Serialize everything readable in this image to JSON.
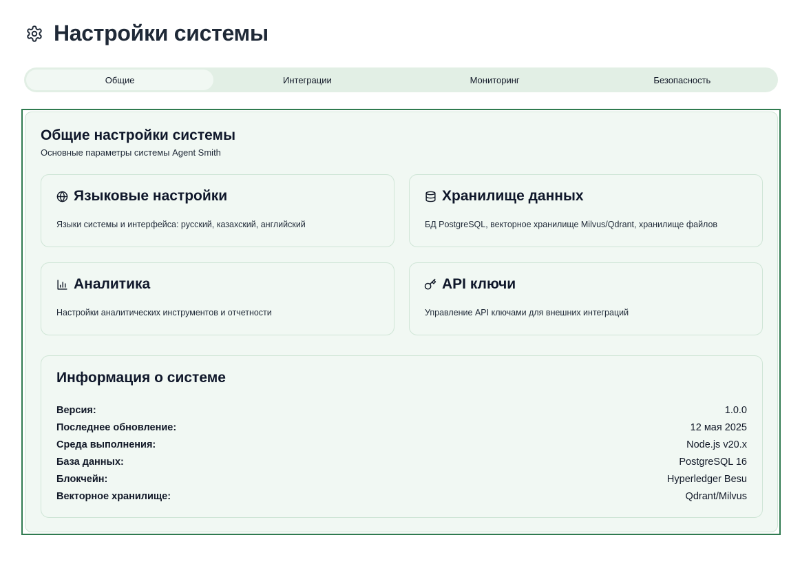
{
  "page": {
    "title": "Настройки системы",
    "icon": "gear-icon"
  },
  "tabs": [
    {
      "label": "Общие",
      "active": true
    },
    {
      "label": "Интеграции",
      "active": false
    },
    {
      "label": "Мониторинг",
      "active": false
    },
    {
      "label": "Безопасность",
      "active": false
    }
  ],
  "general": {
    "title": "Общие настройки системы",
    "subtitle": "Основные параметры системы Agent Smith"
  },
  "cards": [
    {
      "icon": "globe-icon",
      "title": "Языковые настройки",
      "description": "Языки системы и интерфейса: русский, казахский, английский"
    },
    {
      "icon": "database-icon",
      "title": "Хранилище данных",
      "description": "БД PostgreSQL, векторное хранилище Milvus/Qdrant, хранилище файлов"
    },
    {
      "icon": "bar-chart-icon",
      "title": "Аналитика",
      "description": "Настройки аналитических инструментов и отчетности"
    },
    {
      "icon": "key-icon",
      "title": "API ключи",
      "description": "Управление API ключами для внешних интеграций"
    }
  ],
  "system_info": {
    "title": "Информация о системе",
    "rows": [
      {
        "label": "Версия:",
        "value": "1.0.0"
      },
      {
        "label": "Последнее обновление:",
        "value": "12 мая 2025"
      },
      {
        "label": "Среда выполнения:",
        "value": "Node.js v20.x"
      },
      {
        "label": "База данных:",
        "value": "PostgreSQL 16"
      },
      {
        "label": "Блокчейн:",
        "value": "Hyperledger Besu"
      },
      {
        "label": "Векторное хранилище:",
        "value": "Qdrant/Milvus"
      }
    ]
  },
  "colors": {
    "accent": "#2f7a4f",
    "panel_bg": "#f1f8f3",
    "tabs_bg": "#e2efe5"
  }
}
